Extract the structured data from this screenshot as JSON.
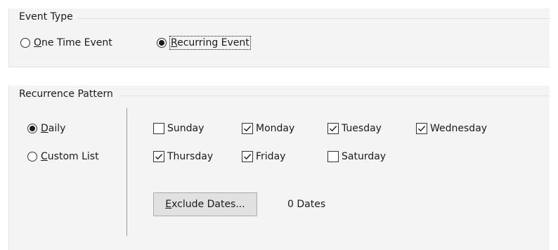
{
  "event_type": {
    "title": "Event Type",
    "options": [
      {
        "mnemonic": "O",
        "rest": "ne Time Event",
        "checked": false
      },
      {
        "mnemonic": "R",
        "rest": "ecurring Event",
        "checked": true
      }
    ]
  },
  "recurrence": {
    "title": "Recurrence Pattern",
    "options": [
      {
        "mnemonic": "D",
        "rest": "aily",
        "checked": true
      },
      {
        "mnemonic": "C",
        "rest": "ustom List",
        "checked": false
      }
    ],
    "days": [
      {
        "label": "Sunday",
        "checked": false
      },
      {
        "label": "Monday",
        "checked": true
      },
      {
        "label": "Tuesday",
        "checked": true
      },
      {
        "label": "Wednesday",
        "checked": true
      },
      {
        "label": "Thursday",
        "checked": true
      },
      {
        "label": "Friday",
        "checked": true
      },
      {
        "label": "Saturday",
        "checked": false
      }
    ],
    "exclude_button": {
      "mnemonic": "E",
      "rest": "xclude Dates..."
    },
    "dates_count": "0 Dates"
  }
}
